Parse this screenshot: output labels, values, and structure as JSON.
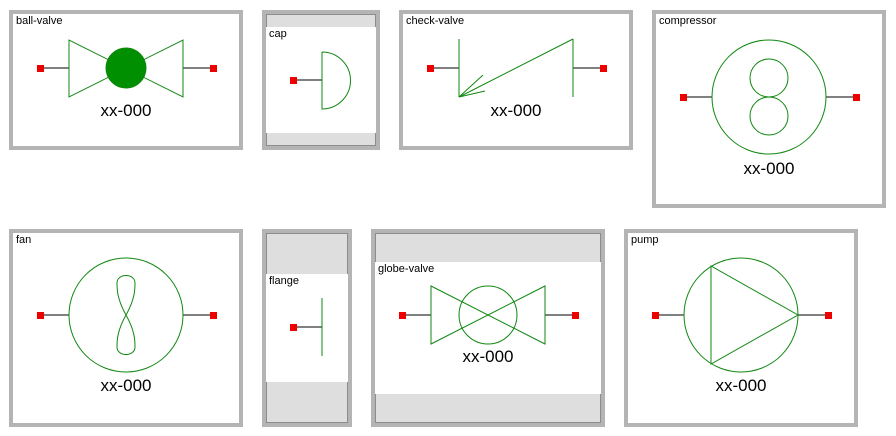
{
  "colors": {
    "symbol_line": "#118811",
    "port": "#ee0000",
    "frame": "#b4b4b4",
    "padding": "#dedede"
  },
  "symbols": [
    {
      "id": "ball-valve",
      "label": "ball-valve",
      "tag": "xx-000"
    },
    {
      "id": "cap",
      "label": "cap",
      "tag": ""
    },
    {
      "id": "check-valve",
      "label": "check-valve",
      "tag": "xx-000"
    },
    {
      "id": "compressor",
      "label": "compressor",
      "tag": "xx-000"
    },
    {
      "id": "fan",
      "label": "fan",
      "tag": "xx-000"
    },
    {
      "id": "flange",
      "label": "flange",
      "tag": ""
    },
    {
      "id": "globe-valve",
      "label": "globe-valve",
      "tag": "xx-000"
    },
    {
      "id": "pump",
      "label": "pump",
      "tag": "xx-000"
    }
  ]
}
